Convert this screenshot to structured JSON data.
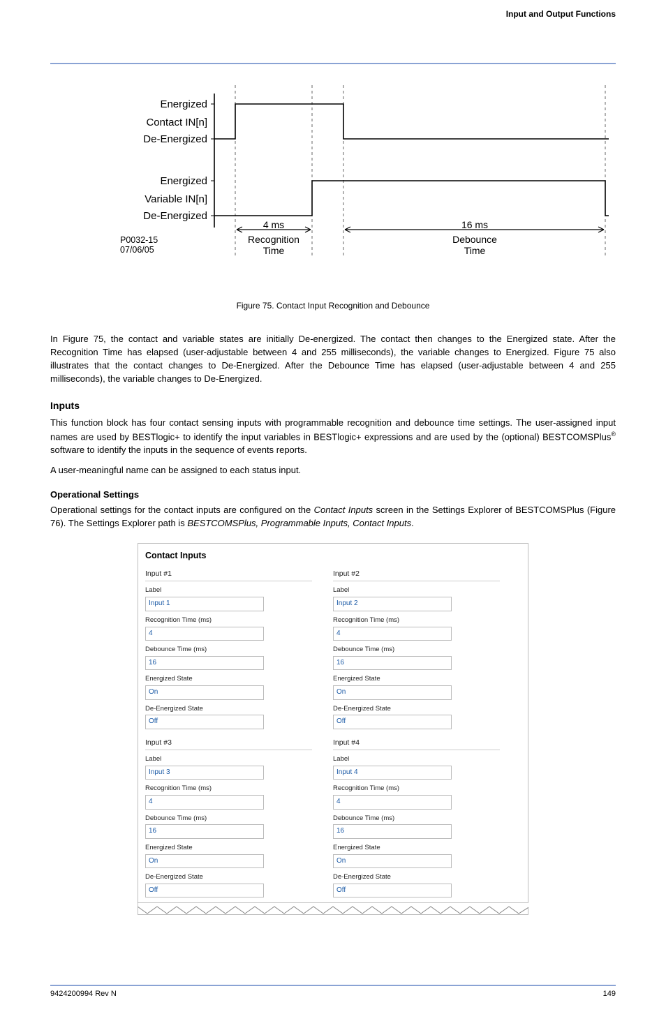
{
  "header": {
    "top_right": "Input and Output Functions"
  },
  "diagram": {
    "left_labels": {
      "contact_energized": "Energized",
      "contact_name": "Contact IN[n]",
      "contact_deenergized": "De-Energized",
      "variable_energized": "Energized",
      "variable_name": "Variable IN[n]",
      "variable_deenergized": "De-Energized"
    },
    "footnote_a": "P0032-15",
    "footnote_b": "07/06/05",
    "recog_ms": "4 ms",
    "recog_label_a": "Recognition",
    "recog_label_b": "Time",
    "deb_ms": "16 ms",
    "deb_label_a": "Debounce",
    "deb_label_b": "Time"
  },
  "caption": "Figure 75. Contact Input Recognition and Debounce",
  "text": {
    "intro": "In Figure 75, the contact and variable states are initially De-energized. The contact then changes to the Energized state. After the Recognition Time has elapsed (user-adjustable between 4 and 255 milliseconds), the variable changes to Energized. Figure 75 also illustrates that the contact changes to De-Energized. After the Debounce Time has elapsed (user-adjustable between 4 and 255 milliseconds), the variable changes to De-Energized.",
    "inputs_heading": "Inputs",
    "inputs_p1": "This function block has four contact sensing inputs with programmable recognition and debounce time settings. The user-assigned input names are used by BESTlogic+ to identify the input variables in BESTlogic+ expressions and are used by the (optional) ",
    "bestcomsplus": "BESTCOMSPlus",
    "inputs_p1b": " software to identify the inputs in the sequence of events reports.",
    "inputs_p2": "A user-meaningful name can be assigned to each status input.",
    "op_heading": "Operational Settings",
    "op_para_a": "Operational settings for the contact inputs are configured on the ",
    "op_para_b": " screen in the Settings Explorer of ",
    "op_para_c": " (Figure 76). The Settings Explorer path is ",
    "op_para_path_a": "BESTCOMSPlus, Programmable Inputs, Contact Inputs",
    "op_para_d": "."
  },
  "italics": {
    "contact_inputs": "Contact Inputs"
  },
  "shot": {
    "title": "Contact Inputs",
    "inputs": [
      {
        "group": "Input #1",
        "label_field": "Label",
        "label_val": "Input 1",
        "rec_field": "Recognition Time (ms)",
        "rec_val": "4",
        "deb_field": "Debounce Time (ms)",
        "deb_val": "16",
        "en_field": "Energized State",
        "en_val": "On",
        "de_field": "De-Energized State",
        "de_val": "Off"
      },
      {
        "group": "Input #2",
        "label_field": "Label",
        "label_val": "Input 2",
        "rec_field": "Recognition Time (ms)",
        "rec_val": "4",
        "deb_field": "Debounce Time (ms)",
        "deb_val": "16",
        "en_field": "Energized State",
        "en_val": "On",
        "de_field": "De-Energized State",
        "de_val": "Off"
      },
      {
        "group": "Input #3",
        "label_field": "Label",
        "label_val": "Input 3",
        "rec_field": "Recognition Time (ms)",
        "rec_val": "4",
        "deb_field": "Debounce Time (ms)",
        "deb_val": "16",
        "en_field": "Energized State",
        "en_val": "On",
        "de_field": "De-Energized State",
        "de_val": "Off"
      },
      {
        "group": "Input #4",
        "label_field": "Label",
        "label_val": "Input 4",
        "rec_field": "Recognition Time (ms)",
        "rec_val": "4",
        "deb_field": "Debounce Time (ms)",
        "deb_val": "16",
        "en_field": "Energized State",
        "en_val": "On",
        "de_field": "De-Energized State",
        "de_val": "Off"
      }
    ]
  },
  "footer": {
    "left": "9424200994 Rev N",
    "right": "149"
  },
  "chart_data": {
    "type": "timing-diagram",
    "traces": [
      {
        "name": "Contact IN[n]",
        "levels": [
          "De-Energized",
          "Energized"
        ],
        "segments": [
          {
            "from": 0,
            "to": 1,
            "level": "De-Energized"
          },
          {
            "from": 1,
            "to": 3,
            "level": "Energized"
          },
          {
            "from": 3,
            "to": 10,
            "level": "De-Energized"
          }
        ]
      },
      {
        "name": "Variable IN[n]",
        "levels": [
          "De-Energized",
          "Energized"
        ],
        "segments": [
          {
            "from": 0,
            "to": 2,
            "level": "De-Energized"
          },
          {
            "from": 2,
            "to": 9.5,
            "level": "Energized"
          },
          {
            "from": 9.5,
            "to": 10,
            "level": "De-Energized"
          }
        ]
      }
    ],
    "annotations": [
      {
        "label": "Recognition Time",
        "value_ms": 4,
        "span": [
          1,
          2
        ]
      },
      {
        "label": "Debounce Time",
        "value_ms": 16,
        "span": [
          3,
          9.5
        ]
      }
    ]
  }
}
